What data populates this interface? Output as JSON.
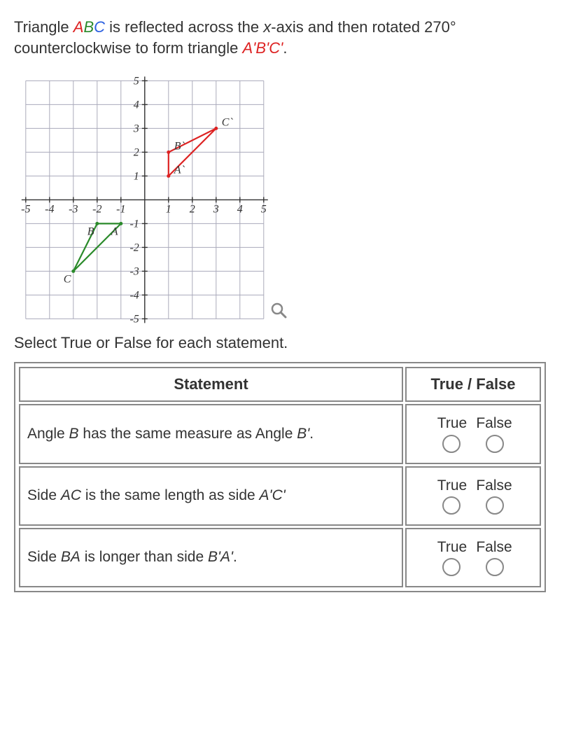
{
  "prompt": {
    "pre": "Triangle ",
    "ABC_A": "A",
    "ABC_B": "B",
    "ABC_C": "C",
    "mid1": " is reflected across the ",
    "xaxis": "x",
    "mid2": "-axis and then rotated 270° counterclockwise to form triangle ",
    "ABCprime": "A'B'C'",
    "end": "."
  },
  "chart_data": {
    "type": "scatter",
    "xlim": [
      -5,
      5
    ],
    "ylim": [
      -5,
      5
    ],
    "xticks": [
      -5,
      -4,
      -3,
      -2,
      -1,
      1,
      2,
      3,
      4,
      5
    ],
    "yticks": [
      -5,
      -4,
      -3,
      -2,
      -1,
      1,
      2,
      3,
      4,
      5
    ],
    "triangles": [
      {
        "name": "ABC",
        "color": "#2a8a2a",
        "points": {
          "A": [
            -1,
            -1
          ],
          "B": [
            -2,
            -1
          ],
          "C": [
            -3,
            -3
          ]
        }
      },
      {
        "name": "A'B'C'",
        "color": "#d22",
        "points": {
          "A`": [
            1,
            1
          ],
          "B`": [
            1,
            2
          ],
          "C`": [
            3,
            3
          ]
        }
      }
    ]
  },
  "instruction": "Select True or False for each statement.",
  "table": {
    "headers": {
      "statement": "Statement",
      "tf": "True / False"
    },
    "tf_labels": {
      "t": "True",
      "f": "False"
    },
    "rows": [
      {
        "statement_pre": "Angle ",
        "em1": "B",
        "mid": " has the same measure as Angle ",
        "em2": "B'",
        "post": "."
      },
      {
        "statement_pre": "Side ",
        "em1": "AC",
        "mid": " is the same length as side ",
        "em2": "A'C'",
        "post": ""
      },
      {
        "statement_pre": "Side ",
        "em1": "BA",
        "mid": " is longer than side ",
        "em2": "B'A'",
        "post": "."
      }
    ]
  }
}
